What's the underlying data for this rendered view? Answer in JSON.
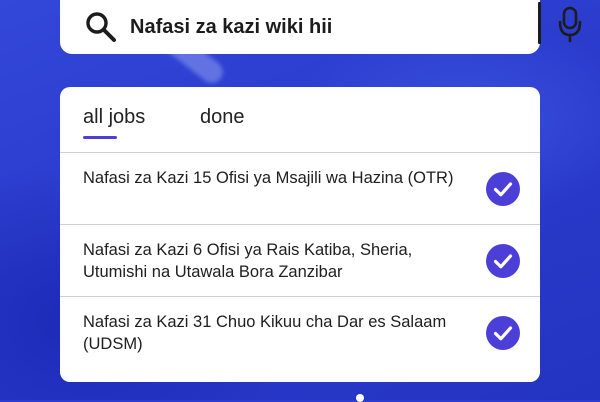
{
  "search": {
    "query": "Nafasi za kazi wiki hii",
    "leading_icon": "search-icon",
    "trailing_icon": "microphone-icon"
  },
  "tabs": [
    {
      "label": "all jobs",
      "active": true
    },
    {
      "label": "done",
      "active": false
    }
  ],
  "jobs": [
    {
      "title": "Nafasi za Kazi 15 Ofisi ya Msajili wa Hazina (OTR)",
      "checked": true
    },
    {
      "title": "Nafasi za Kazi 6 Ofisi ya Rais Katiba, Sheria, Utumishi na Utawala Bora Zanzibar",
      "checked": true
    },
    {
      "title": "Nafasi za Kazi 31 Chuo Kikuu cha Dar es Salaam (UDSM)",
      "checked": true
    }
  ],
  "colors": {
    "background": "#2b3ccf",
    "accent": "#4b3fd8",
    "card": "#ffffff",
    "text": "#202020"
  }
}
